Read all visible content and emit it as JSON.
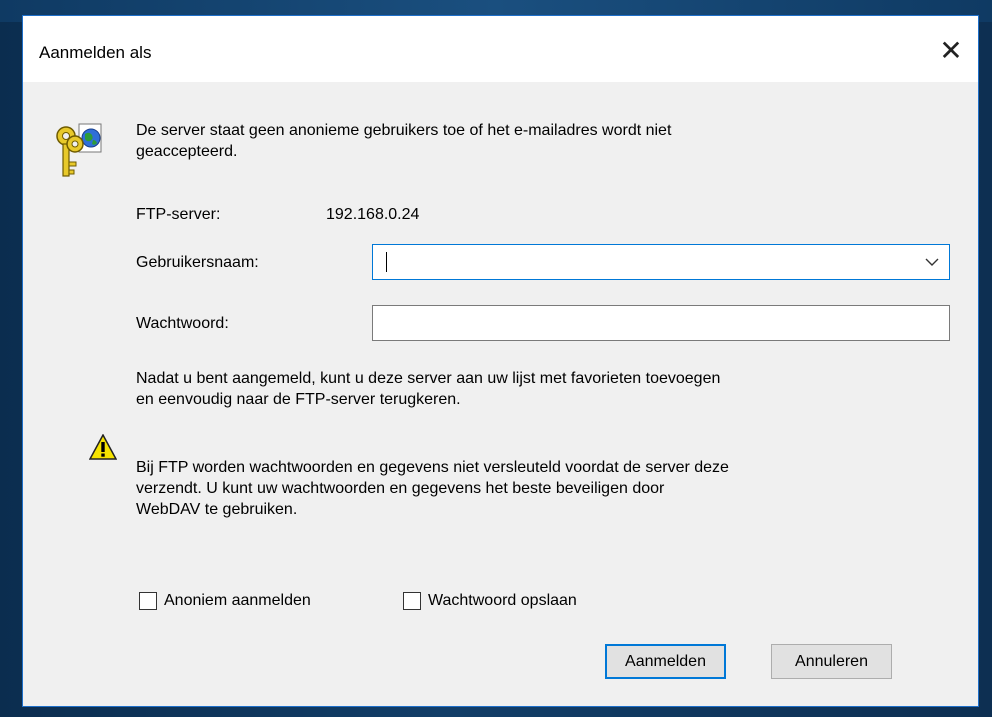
{
  "dialog": {
    "title": "Aanmelden als",
    "close_glyph": "✕",
    "message": [
      "De server staat geen anonieme gebruikers toe of het e-mailadres wordt niet",
      "geaccepteerd."
    ],
    "ftp_server_label": "FTP-server:",
    "ftp_server_value": "192.168.0.24",
    "username_label": "Gebruikersnaam:",
    "username_value": "",
    "password_label": "Wachtwoord:",
    "password_value": "",
    "info": [
      "Nadat u bent aangemeld, kunt u deze server aan uw lijst met favorieten toevoegen",
      "en eenvoudig naar de FTP-server terugkeren."
    ],
    "warning": [
      "Bij FTP worden wachtwoorden en gegevens niet versleuteld voordat de server deze",
      "verzendt. U kunt uw wachtwoorden en gegevens het beste beveiligen door",
      "WebDAV te gebruiken."
    ],
    "anonymous_checkbox_label": "Anoniem aanmelden",
    "anonymous_checked": false,
    "save_password_label": "Wachtwoord opslaan",
    "save_password_checked": false,
    "login_button": "Aanmelden",
    "cancel_button": "Annuleren",
    "icons": {
      "header": "keys-globe-icon",
      "warning": "warning-icon",
      "dropdown": "chevron-down-icon"
    },
    "colors": {
      "accent": "#0078d7",
      "dialog_bg": "#f0f0f0",
      "titlebar_bg": "#ffffff"
    }
  }
}
